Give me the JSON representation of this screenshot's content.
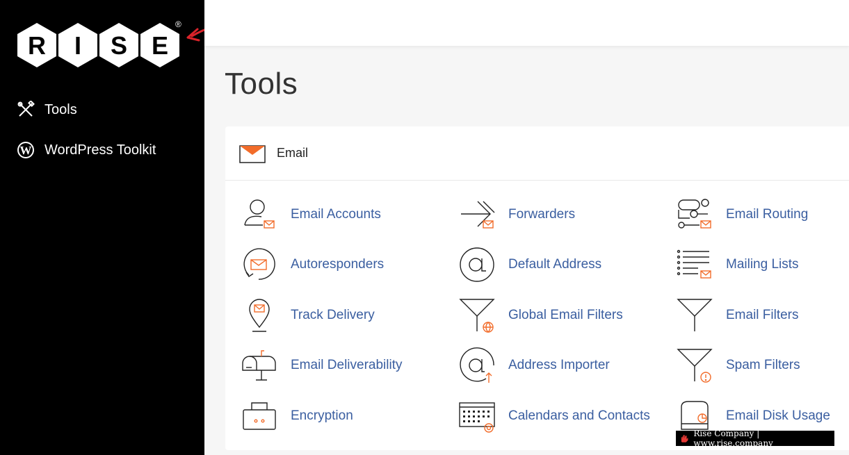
{
  "brand": {
    "letters": [
      "R",
      "I",
      "S",
      "E"
    ],
    "registered": "®"
  },
  "sidebar": {
    "items": [
      {
        "label": "Tools",
        "icon": "wrench-screwdriver-icon"
      },
      {
        "label": "WordPress Toolkit",
        "icon": "wordpress-icon"
      }
    ]
  },
  "page": {
    "title": "Tools"
  },
  "email_section": {
    "title": "Email",
    "items": [
      {
        "label": "Email Accounts",
        "icon": "user-mail-icon"
      },
      {
        "label": "Forwarders",
        "icon": "forward-arrow-icon"
      },
      {
        "label": "Email Routing",
        "icon": "routing-icon"
      },
      {
        "label": "Autoresponders",
        "icon": "autoresponder-icon"
      },
      {
        "label": "Default Address",
        "icon": "at-sign-icon"
      },
      {
        "label": "Mailing Lists",
        "icon": "mailing-list-icon"
      },
      {
        "label": "Track Delivery",
        "icon": "location-pin-mail-icon"
      },
      {
        "label": "Global Email Filters",
        "icon": "global-filter-icon"
      },
      {
        "label": "Email Filters",
        "icon": "filter-icon"
      },
      {
        "label": "Email Deliverability",
        "icon": "mailbox-icon"
      },
      {
        "label": "Address Importer",
        "icon": "at-import-icon"
      },
      {
        "label": "Spam Filters",
        "icon": "spam-filter-icon"
      },
      {
        "label": "Encryption",
        "icon": "encryption-icon"
      },
      {
        "label": "Calendars and Contacts",
        "icon": "calendar-icon"
      },
      {
        "label": "Email Disk Usage",
        "icon": "disk-usage-icon"
      }
    ]
  },
  "watermark": {
    "text": "Rise Company | www.rise.company"
  },
  "colors": {
    "accent": "#f26c2a",
    "link": "#3a5ea0",
    "sidebar_bg": "#000000"
  }
}
